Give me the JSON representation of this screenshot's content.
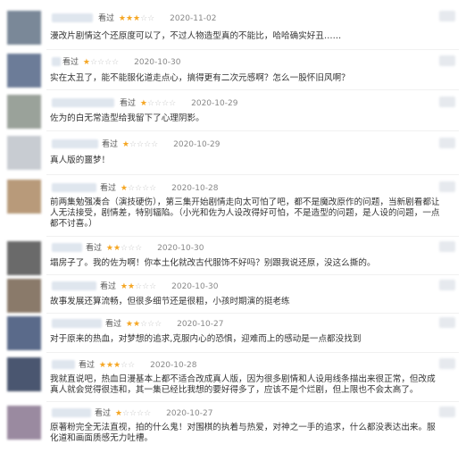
{
  "comments": [
    {
      "seen": "看过",
      "stars": "★★★",
      "stars_off": "☆☆",
      "date": "2020-11-02",
      "text": "漫改片剧情这个还原度可以了，不过人物造型真的不能比，哈哈确实好丑……",
      "avatar_color": "#7a8898"
    },
    {
      "seen": "看过",
      "stars": "★",
      "stars_off": "☆☆☆☆",
      "date": "2020-10-30",
      "text": "实在太丑了，能不能服化道走点心，搞得更有二次元感啊？怎么一股怀旧风啊？",
      "avatar_color": "#6c7c98"
    },
    {
      "seen": "看过",
      "stars": "★",
      "stars_off": "☆☆☆☆",
      "date": "2020-10-29",
      "text": "佐为的白无常造型给我留下了心理阴影。",
      "avatar_color": "#9aa29a"
    },
    {
      "seen": "看过",
      "stars": "★",
      "stars_off": "☆☆☆☆",
      "date": "2020-10-29",
      "text": "真人版的噩梦！",
      "avatar_color": "#c8ccd2"
    },
    {
      "seen": "看过",
      "stars": "★",
      "stars_off": "☆☆☆☆",
      "date": "2020-10-28",
      "text": "前两集勉强凑合（演技硬伤），第三集开始剧情走向太可怕了吧，都不是魔改原作的问题，当新剧看都让人无法接受，剧情差，特别辐陷。（小光和佐为人设改得好可怕，不是造型的问题，是人设的问题，一点都不讨喜。）",
      "avatar_color": "#b89a7a"
    },
    {
      "seen": "看过",
      "stars": "★★",
      "stars_off": "☆☆☆",
      "date": "2020-10-30",
      "text": "塌房子了。我的佐为啊！你本土化就改古代服饰不好吗？别跟我说还原，没这么撕的。",
      "avatar_color": "#6a6a6a"
    },
    {
      "seen": "看过",
      "stars": "★★",
      "stars_off": "☆☆☆",
      "date": "2020-10-30",
      "text": "故事发展还算流畅，但很多细节还是很粗，小孩时期演的挺老练",
      "avatar_color": "#8a7a6a"
    },
    {
      "seen": "看过",
      "stars": "★★",
      "stars_off": "☆☆☆",
      "date": "2020-10-27",
      "text": "对于原来的热血，对梦想的追求,克服内心的恐惧，迎难而上的感动是一点都没找到",
      "avatar_color": "#5a6a8a"
    },
    {
      "seen": "看过",
      "stars": "★★★",
      "stars_off": "☆☆",
      "date": "2020-10-28",
      "text": "我就直说吧，热血日漫基本上都不适合改成真人版，因为很多剧情和人设用线条描出来很正常，但改成真人就会觉得很违和，其一集已经比我想的要好得多了，应该不是个烂剧，但上限也不会太高了。",
      "avatar_color": "#4a5670"
    },
    {
      "seen": "看过",
      "stars": "★",
      "stars_off": "☆☆☆☆",
      "date": "2020-10-27",
      "text": "原著粉完全无法直视，拍的什么鬼！对围棋的执着与热爱，对神之一手的追求，什么都没表达出来。服化道和画面质感无力吐槽。",
      "avatar_color": "#9a8aa0"
    }
  ]
}
